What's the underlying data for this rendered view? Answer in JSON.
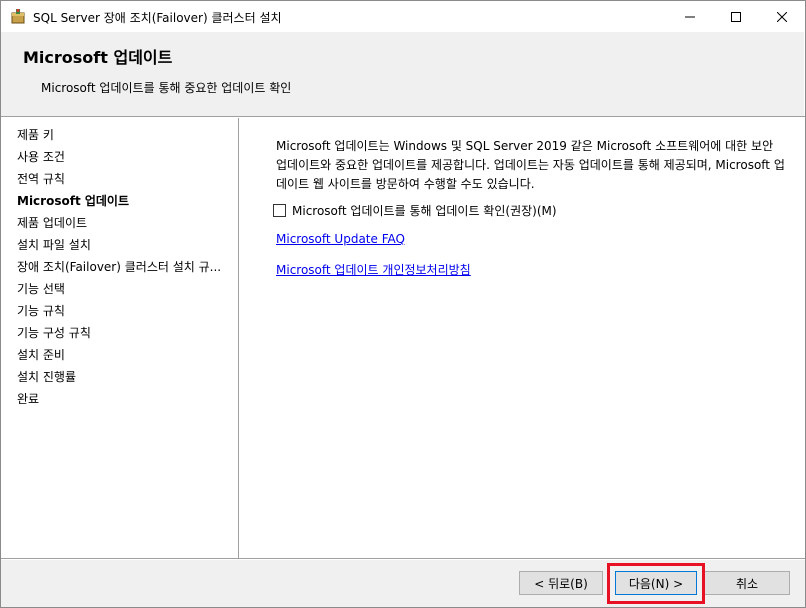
{
  "window": {
    "title": "SQL Server 장애 조치(Failover) 클러스터 설치"
  },
  "header": {
    "title": "Microsoft 업데이트",
    "subtitle": "Microsoft 업데이트를 통해 중요한 업데이트 확인"
  },
  "sidebar": {
    "items": [
      {
        "label": "제품 키"
      },
      {
        "label": "사용 조건"
      },
      {
        "label": "전역 규칙"
      },
      {
        "label": "Microsoft 업데이트"
      },
      {
        "label": "제품 업데이트"
      },
      {
        "label": "설치 파일 설치"
      },
      {
        "label": "장애 조치(Failover) 클러스터 설치 규..."
      },
      {
        "label": "기능 선택"
      },
      {
        "label": "기능 규칙"
      },
      {
        "label": "기능 구성 규칙"
      },
      {
        "label": "설치 준비"
      },
      {
        "label": "설치 진행률"
      },
      {
        "label": "완료"
      }
    ],
    "active_index": 3
  },
  "content": {
    "description": "Microsoft 업데이트는 Windows 및 SQL Server 2019 같은 Microsoft 소프트웨어에 대한 보안 업데이트와 중요한 업데이트를 제공합니다. 업데이트는 자동 업데이트를 통해 제공되며, Microsoft 업데이트 웹 사이트를 방문하여 수행할 수도 있습니다.",
    "checkbox_label": "Microsoft 업데이트를 통해 업데이트 확인(권장)(M)",
    "checkbox_checked": false,
    "link_faq": "Microsoft Update FAQ",
    "link_privacy": "Microsoft 업데이트 개인정보처리방침"
  },
  "footer": {
    "back_label": "< 뒤로(B)",
    "next_label": "다음(N) >",
    "cancel_label": "취소"
  },
  "colors": {
    "highlight": "#e81123",
    "link": "#0000ee",
    "panel": "#f0f0f0"
  }
}
